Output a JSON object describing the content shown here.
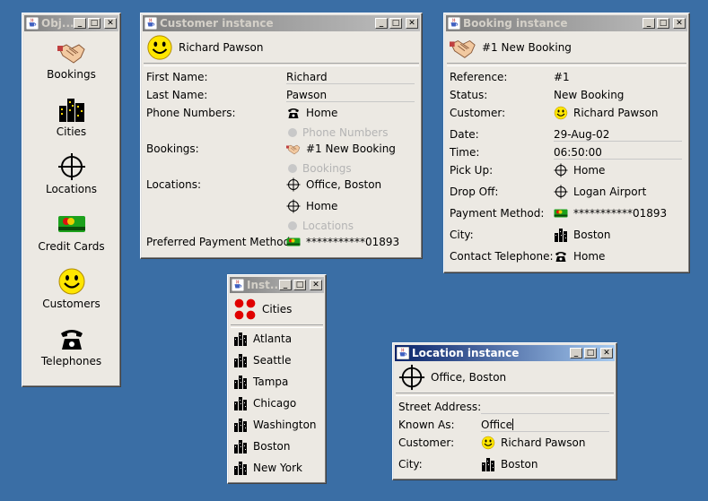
{
  "objects_window": {
    "title": "Obj...",
    "items": [
      {
        "label": "Bookings",
        "icon": "handshake-icon"
      },
      {
        "label": "Cities",
        "icon": "city-icon"
      },
      {
        "label": "Locations",
        "icon": "crosshair-icon"
      },
      {
        "label": "Credit Cards",
        "icon": "credit-card-icon"
      },
      {
        "label": "Customers",
        "icon": "smiley-icon"
      },
      {
        "label": "Telephones",
        "icon": "telephone-icon"
      }
    ]
  },
  "customer_window": {
    "title": "Customer instance",
    "header": "Richard Pawson",
    "fields": {
      "first_name_label": "First Name:",
      "first_name": "Richard",
      "last_name_label": "Last Name:",
      "last_name": "Pawson",
      "phone_label": "Phone Numbers:",
      "phone_value": "Home",
      "phone_ghost": "Phone Numbers",
      "bookings_label": "Bookings:",
      "bookings_value": "#1 New Booking",
      "bookings_ghost": "Bookings",
      "locations_label": "Locations:",
      "location_1": "Office, Boston",
      "location_2": "Home",
      "locations_ghost": "Locations",
      "payment_label": "Preferred Payment Method:",
      "payment_value": "***********01893"
    }
  },
  "booking_window": {
    "title": "Booking instance",
    "header": "#1 New Booking",
    "fields": {
      "reference_label": "Reference:",
      "reference": "#1",
      "status_label": "Status:",
      "status": "New Booking",
      "customer_label": "Customer:",
      "customer": "Richard Pawson",
      "date_label": "Date:",
      "date": "29-Aug-02",
      "time_label": "Time:",
      "time": "06:50:00",
      "pickup_label": "Pick Up:",
      "pickup": "Home",
      "dropoff_label": "Drop Off:",
      "dropoff": "Logan Airport",
      "payment_label": "Payment Method:",
      "payment": "***********01893",
      "city_label": "City:",
      "city": "Boston",
      "contact_label": "Contact Telephone:",
      "contact": "Home"
    }
  },
  "cities_window": {
    "title": "Inst...",
    "header": "Cities",
    "cities": [
      "Atlanta",
      "Seattle",
      "Tampa",
      "Chicago",
      "Washington",
      "Boston",
      "New York"
    ]
  },
  "location_window": {
    "title": "Location instance",
    "header": "Office, Boston",
    "fields": {
      "street_label": "Street Address:",
      "street": "",
      "known_label": "Known As:",
      "known": "Office",
      "customer_label": "Customer:",
      "customer": "Richard Pawson",
      "city_label": "City:",
      "city": "Boston"
    }
  },
  "colors": {
    "desktop": "#3a6ea5",
    "active_title": "#0a246a",
    "inactive_title": "#808080"
  }
}
